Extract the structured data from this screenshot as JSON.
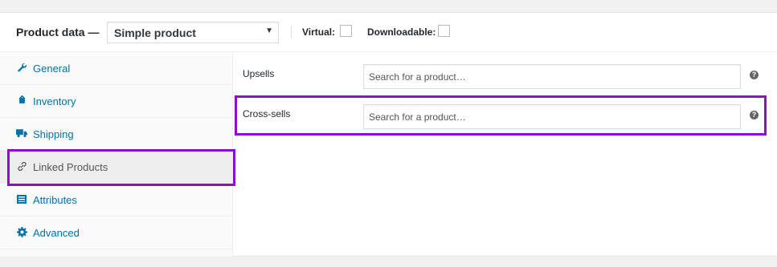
{
  "header": {
    "title": "Product data —",
    "product_type": "Simple product",
    "virtual_label": "Virtual:",
    "virtual_checked": false,
    "downloadable_label": "Downloadable:",
    "downloadable_checked": false
  },
  "sidebar": {
    "items": [
      {
        "label": "General",
        "icon": "wrench-icon",
        "active": false
      },
      {
        "label": "Inventory",
        "icon": "tag-icon",
        "active": false
      },
      {
        "label": "Shipping",
        "icon": "truck-icon",
        "active": false
      },
      {
        "label": "Linked Products",
        "icon": "link-icon",
        "active": true
      },
      {
        "label": "Attributes",
        "icon": "list-icon",
        "active": false
      },
      {
        "label": "Advanced",
        "icon": "gear-icon",
        "active": false
      }
    ]
  },
  "main": {
    "upsells": {
      "label": "Upsells",
      "placeholder": "Search for a product…",
      "help": "?"
    },
    "crosssells": {
      "label": "Cross-sells",
      "placeholder": "Search for a product…",
      "help": "?"
    }
  },
  "colors": {
    "link": "#0073aa",
    "highlight": "#8a0fd1",
    "active_tab_bg": "#eeeeee"
  }
}
